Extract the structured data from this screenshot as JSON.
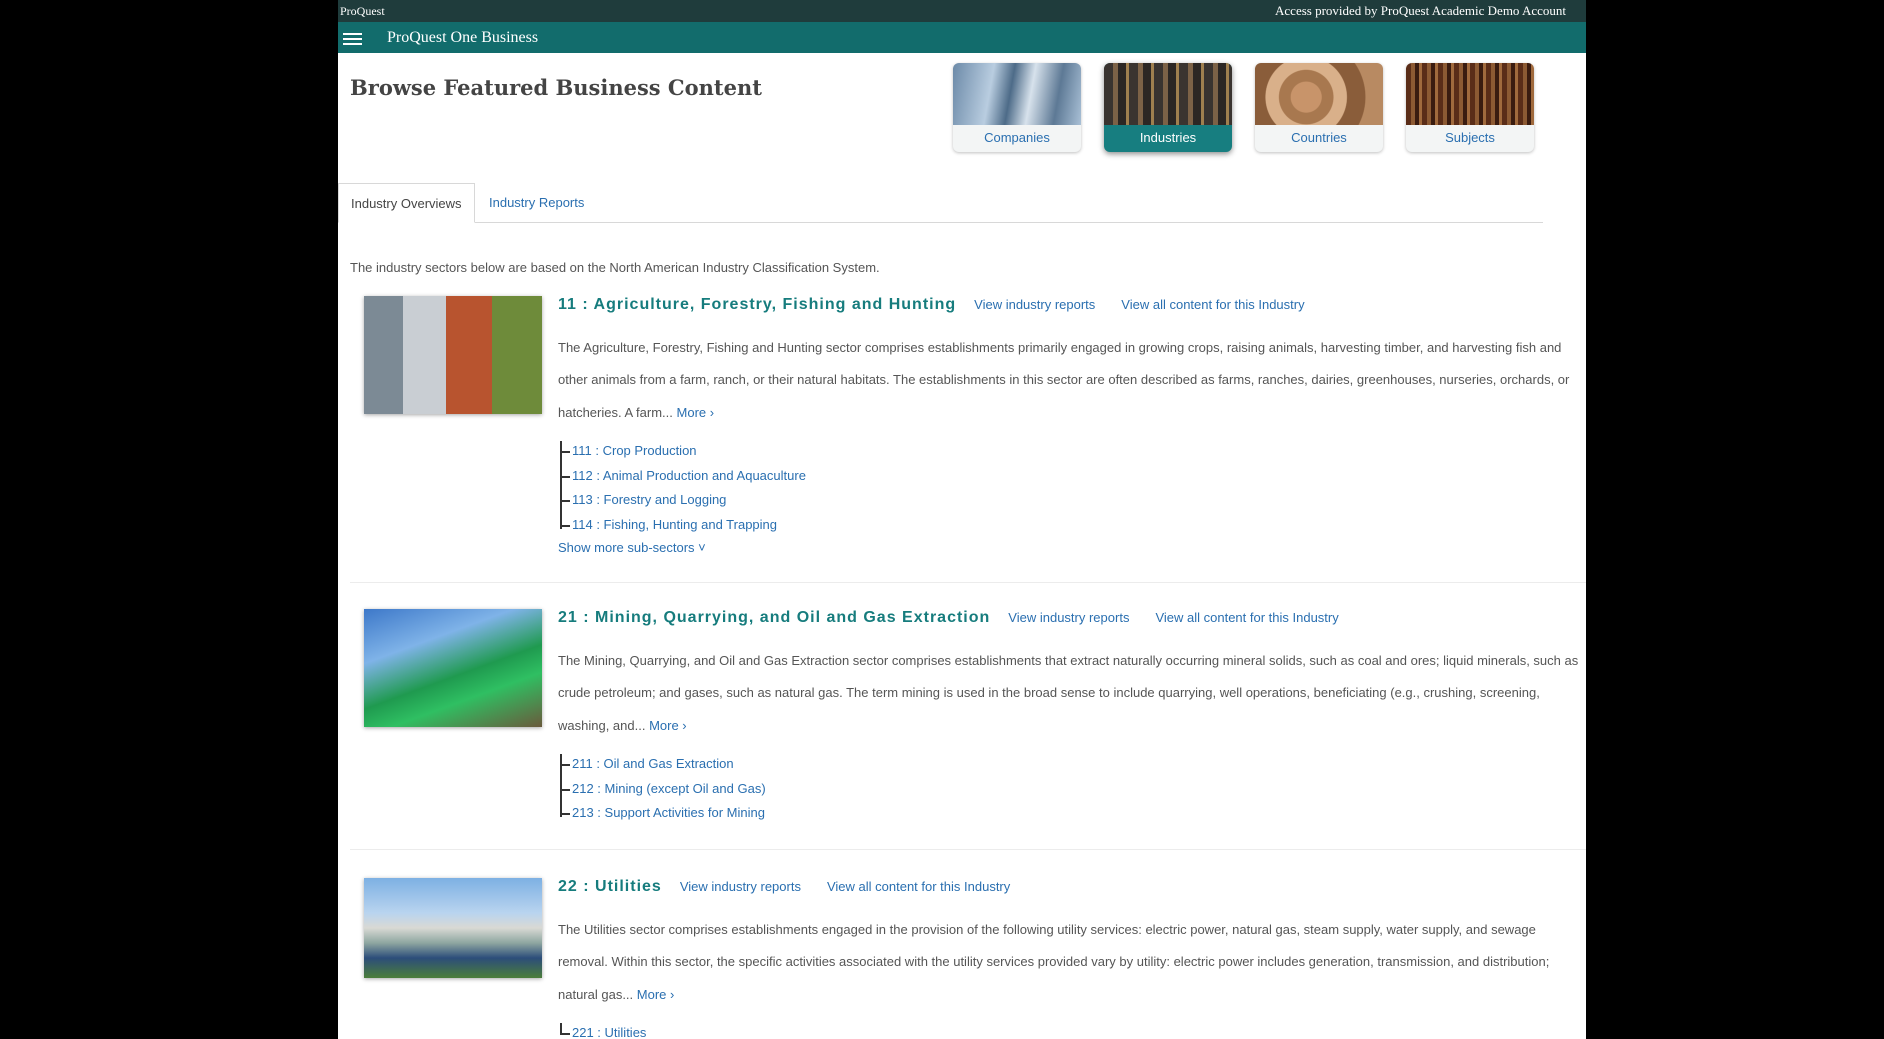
{
  "topbar": {
    "brand": "ProQuest",
    "access": "Access provided by ProQuest Academic Demo Account"
  },
  "navbar": {
    "menu_icon": "hamburger-icon",
    "product": "ProQuest One Business"
  },
  "page": {
    "title": "Browse Featured Business Content"
  },
  "categories": [
    {
      "label": "Companies",
      "active": false
    },
    {
      "label": "Industries",
      "active": true
    },
    {
      "label": "Countries",
      "active": false
    },
    {
      "label": "Subjects",
      "active": false
    }
  ],
  "tabs": {
    "overviews": "Industry Overviews",
    "reports": "Industry Reports"
  },
  "intro": "The industry sectors below are based on the North American Industry Classification System.",
  "common": {
    "view_reports": "View industry reports",
    "view_all": "View all content for this Industry",
    "more": "More ›",
    "show_more": "Show more sub-sectors ˅"
  },
  "sectors": [
    {
      "title": "11 : Agriculture, Forestry, Fishing and Hunting",
      "description": "The Agriculture, Forestry, Fishing and Hunting sector comprises establishments primarily engaged in growing crops, raising animals, harvesting timber, and harvesting fish and other animals from a farm, ranch, or their natural habitats. The establishments in this sector are often described as farms, ranches, dairies, greenhouses, nurseries, orchards, or hatcheries. A farm...",
      "subsectors": [
        "111 : Crop Production",
        "112 : Animal Production and Aquaculture",
        "113 : Forestry and Logging",
        "114 : Fishing, Hunting and Trapping"
      ]
    },
    {
      "title": "21 : Mining, Quarrying, and Oil and Gas Extraction",
      "description": "The Mining, Quarrying, and Oil and Gas Extraction sector comprises establishments that extract naturally occurring mineral solids, such as coal and ores; liquid minerals, such as crude petroleum; and gases, such as natural gas. The term mining is used in the broad sense to include quarrying, well operations, beneficiating (e.g., crushing, screening, washing, and...",
      "subsectors": [
        "211 : Oil and Gas Extraction",
        "212 : Mining (except Oil and Gas)",
        "213 : Support Activities for Mining"
      ]
    },
    {
      "title": "22 : Utilities",
      "description": "The Utilities sector comprises establishments engaged in the provision of the following utility services: electric power, natural gas, steam supply, water supply, and sewage removal. Within this sector, the specific activities associated with the utility services provided vary by utility: electric power includes generation, transmission, and distribution; natural gas...",
      "subsectors": [
        "221 : Utilities"
      ]
    }
  ]
}
